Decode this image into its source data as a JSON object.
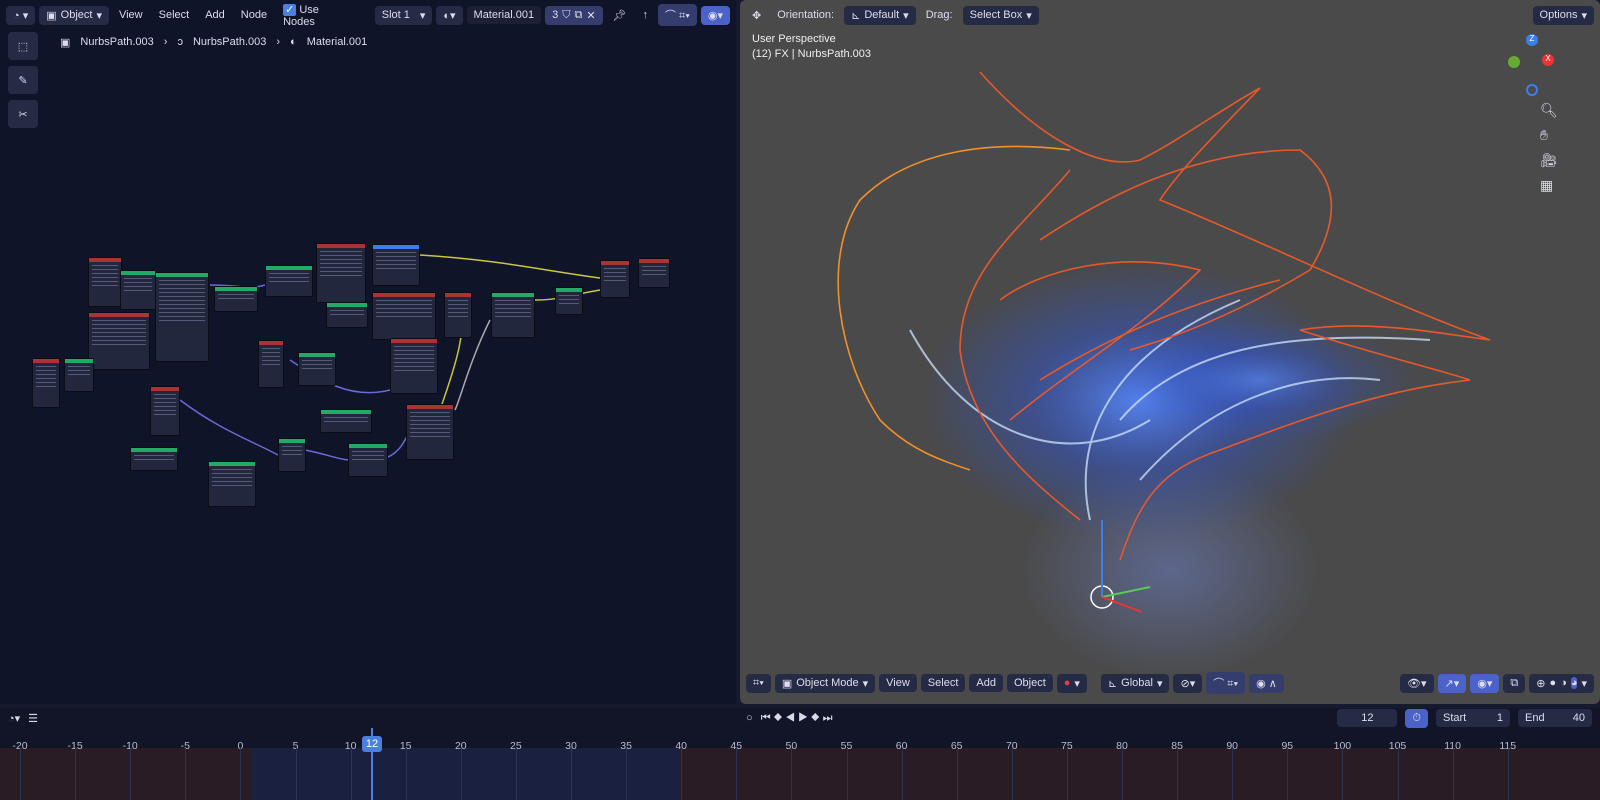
{
  "node_header": {
    "editor_type": "Object",
    "menus": [
      "View",
      "Select",
      "Add",
      "Node"
    ],
    "use_nodes_label": "Use Nodes",
    "slot": "Slot 1",
    "material": "Material.001",
    "users": "3"
  },
  "breadcrumb": [
    "NurbsPath.003",
    "NurbsPath.003",
    "Material.001"
  ],
  "viewport_header": {
    "orientation_label": "Orientation:",
    "orientation": "Default",
    "drag_label": "Drag:",
    "drag": "Select Box",
    "options": "Options"
  },
  "viewport_info": {
    "view": "User Perspective",
    "object": "(12) FX | NurbsPath.003"
  },
  "gizmo": {
    "z": "Z",
    "x": "X"
  },
  "viewport_footer": {
    "mode": "Object Mode",
    "menus": [
      "View",
      "Select",
      "Add",
      "Object"
    ],
    "transform": "Global"
  },
  "timeline": {
    "current_frame": "12",
    "start_label": "Start",
    "start": "1",
    "end_label": "End",
    "end": "40",
    "ticks": [
      "-20",
      "-15",
      "-10",
      "-5",
      "0",
      "5",
      "10",
      "15",
      "20",
      "25",
      "30",
      "35",
      "40",
      "45",
      "50",
      "55",
      "60",
      "65",
      "70",
      "75",
      "80",
      "85",
      "90",
      "95",
      "100",
      "105",
      "110",
      "115"
    ]
  },
  "colors": {
    "accent": "#4b63c9",
    "curve": "#e8592a",
    "glow": "#3a6bff"
  }
}
